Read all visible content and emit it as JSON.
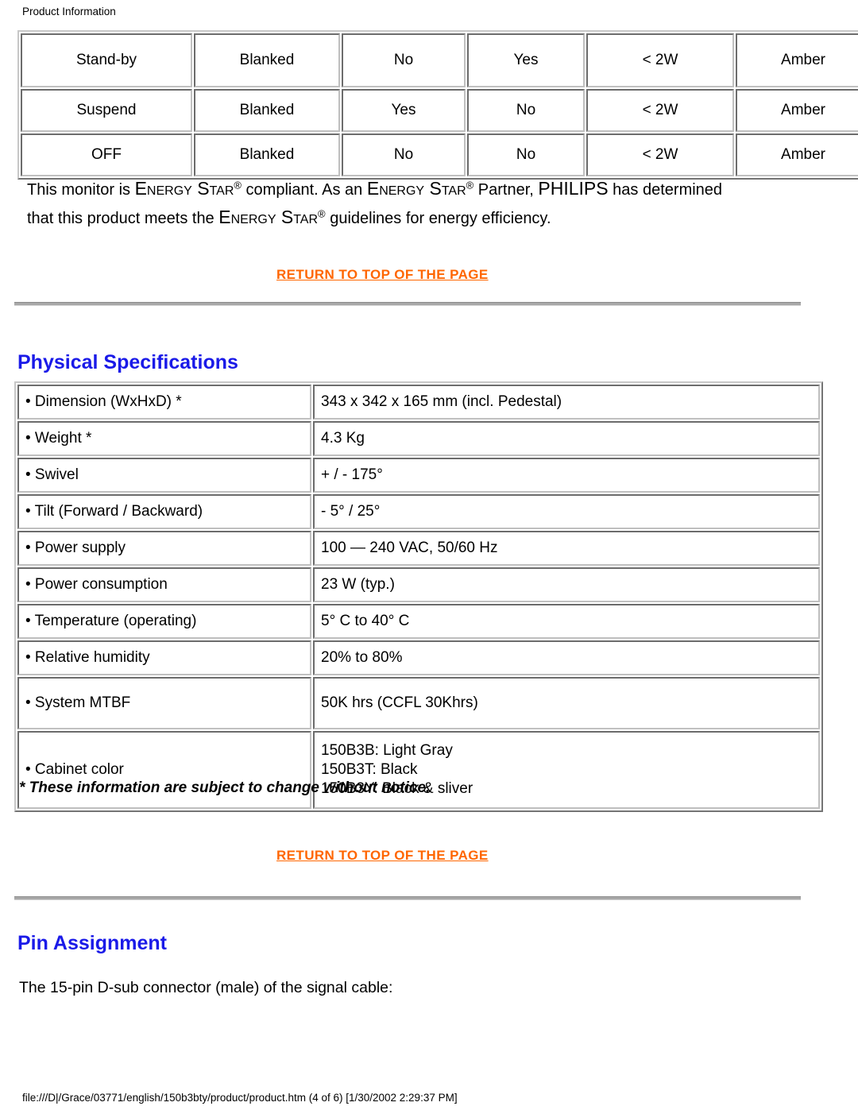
{
  "header": {
    "title": "Product Information"
  },
  "power_table": {
    "rows": [
      {
        "mode": "Stand-by",
        "video": "Blanked",
        "hsync": "No",
        "vsync": "Yes",
        "power": "< 2W",
        "led": "Amber"
      },
      {
        "mode": "Suspend",
        "video": "Blanked",
        "hsync": "Yes",
        "vsync": "No",
        "power": "< 2W",
        "led": "Amber"
      },
      {
        "mode": "OFF",
        "video": "Blanked",
        "hsync": "No",
        "vsync": "No",
        "power": "< 2W",
        "led": "Amber"
      }
    ]
  },
  "energy_star": {
    "seg1": "This monitor is ",
    "brand1": "Energy Star",
    "seg2": " compliant. As an ",
    "brand2": "Energy Star",
    "seg3": " Partner, ",
    "company": "PHILIPS",
    "seg4": " has determined that this product meets the ",
    "brand3": "Energy Star",
    "seg5": " guidelines for energy efficiency.",
    "registered_mark": "®"
  },
  "links": {
    "return_to_top": "RETURN TO TOP OF THE PAGE"
  },
  "sections": {
    "physical_specifications": "Physical Specifications",
    "pin_assignment": "Pin Assignment"
  },
  "spec_table": {
    "rows": [
      {
        "label": "• Dimension (WxHxD) *",
        "value": "343 x 342 x 165 mm (incl. Pedestal)"
      },
      {
        "label": "• Weight *",
        "value": "4.3 Kg"
      },
      {
        "label": "• Swivel",
        "value": "+ / - 175°"
      },
      {
        "label": "• Tilt (Forward / Backward)",
        "value": "- 5° / 25°"
      },
      {
        "label": "• Power supply",
        "value": "100 — 240 VAC, 50/60 Hz"
      },
      {
        "label": "• Power consumption",
        "value": "23 W (typ.)"
      },
      {
        "label": "• Temperature (operating)",
        "value": "5° C to 40° C"
      },
      {
        "label": "• Relative humidity",
        "value": "20% to 80%"
      },
      {
        "label": "• System MTBF",
        "value": "50K hrs (CCFL 30Khrs)"
      }
    ],
    "cabinet_row": {
      "label": "• Cabinet color",
      "value_lines": [
        "150B3B: Light Gray",
        "150B3T: Black",
        "150B3Y: Black & sliver"
      ]
    }
  },
  "footnote": "* These information are subject to change without notice.",
  "pin_description": "The 15-pin D-sub connector (male) of the signal cable:",
  "footer": {
    "path": "file:///D|/Grace/03771/english/150b3bty/product/product.htm (4 of 6) [1/30/2002 2:29:37 PM]"
  },
  "colors": {
    "heading_blue": "#1a1ae8",
    "link_orange": "#ff6600",
    "text_black": "#000000",
    "page_background": "#ffffff"
  }
}
